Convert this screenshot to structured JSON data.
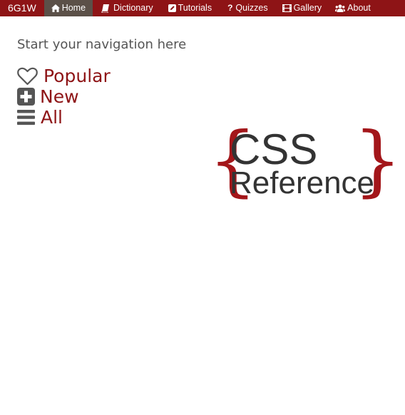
{
  "nav": {
    "brand": "6G1W",
    "items": [
      {
        "label": "Home",
        "icon": "home-icon",
        "active": true
      },
      {
        "label": "Dictionary",
        "icon": "book-icon",
        "active": false
      },
      {
        "label": "Tutorials",
        "icon": "edit-icon",
        "active": false
      },
      {
        "label": "Quizzes",
        "icon": "question-icon",
        "active": false
      },
      {
        "label": "Gallery",
        "icon": "film-icon",
        "active": false
      },
      {
        "label": "About",
        "icon": "users-icon",
        "active": false
      }
    ]
  },
  "main": {
    "intro": "Start your navigation here",
    "links": [
      {
        "label": "Popular",
        "icon": "heart-icon"
      },
      {
        "label": "New",
        "icon": "plus-square-icon"
      },
      {
        "label": "All",
        "icon": "list-icon"
      }
    ]
  },
  "logo": {
    "brace_open": "{",
    "line1": "CSS",
    "line2": "Reference",
    "brace_close": "}"
  },
  "colors": {
    "nav_bg": "#8e1416",
    "nav_active_bg": "#5b5048",
    "accent": "#8e1416",
    "brace": "#a3161a",
    "text_dark": "#333333",
    "text_muted": "#555555"
  }
}
